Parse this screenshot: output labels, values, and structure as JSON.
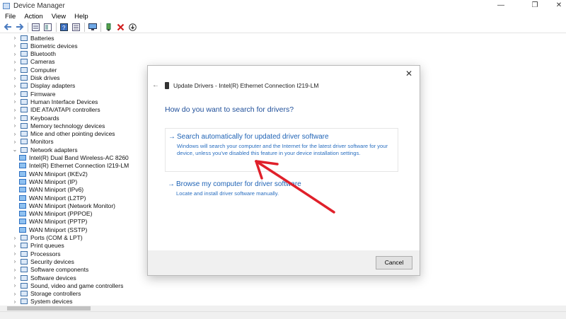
{
  "window": {
    "title": "Device Manager",
    "controls": {
      "minimize": "—",
      "restore": "❐",
      "close": "✕"
    }
  },
  "menubar": [
    "File",
    "Action",
    "View",
    "Help"
  ],
  "toolbar": [
    "back-icon",
    "forward-icon",
    "properties-icon",
    "show-hide-icon",
    "help-icon",
    "list-icon",
    "monitor-icon",
    "update-driver-icon",
    "uninstall-icon",
    "download-icon"
  ],
  "tree": {
    "categories": [
      "Batteries",
      "Biometric devices",
      "Bluetooth",
      "Cameras",
      "Computer",
      "Disk drives",
      "Display adapters",
      "Firmware",
      "Human Interface Devices",
      "IDE ATA/ATAPI controllers",
      "Keyboards",
      "Memory technology devices",
      "Mice and other pointing devices",
      "Monitors",
      "Network adapters"
    ],
    "network_adapters": [
      "Intel(R) Dual Band Wireless-AC 8260",
      "Intel(R) Ethernet Connection I219-LM",
      "WAN Miniport (IKEv2)",
      "WAN Miniport (IP)",
      "WAN Miniport (IPv6)",
      "WAN Miniport (L2TP)",
      "WAN Miniport (Network Monitor)",
      "WAN Miniport (PPPOE)",
      "WAN Miniport (PPTP)",
      "WAN Miniport (SSTP)"
    ],
    "categories_after": [
      "Ports (COM & LPT)",
      "Print queues",
      "Processors",
      "Security devices",
      "Software components",
      "Software devices",
      "Sound, video and game controllers",
      "Storage controllers",
      "System devices"
    ]
  },
  "dialog": {
    "header": "Update Drivers - Intel(R) Ethernet Connection I219-LM",
    "question": "How do you want to search for drivers?",
    "option1_title": "Search automatically for updated driver software",
    "option1_desc": "Windows will search your computer and the Internet for the latest driver software for your device, unless you've disabled this feature in your device installation settings.",
    "option2_title": "Browse my computer for driver software",
    "option2_desc": "Locate and install driver software manually.",
    "cancel": "Cancel",
    "close_glyph": "✕",
    "back_glyph": "←",
    "arrow_glyph": "→"
  },
  "colors": {
    "link_blue": "#1f63b5",
    "question_blue": "#1f4f9a",
    "annotation_red": "#e0202a"
  }
}
